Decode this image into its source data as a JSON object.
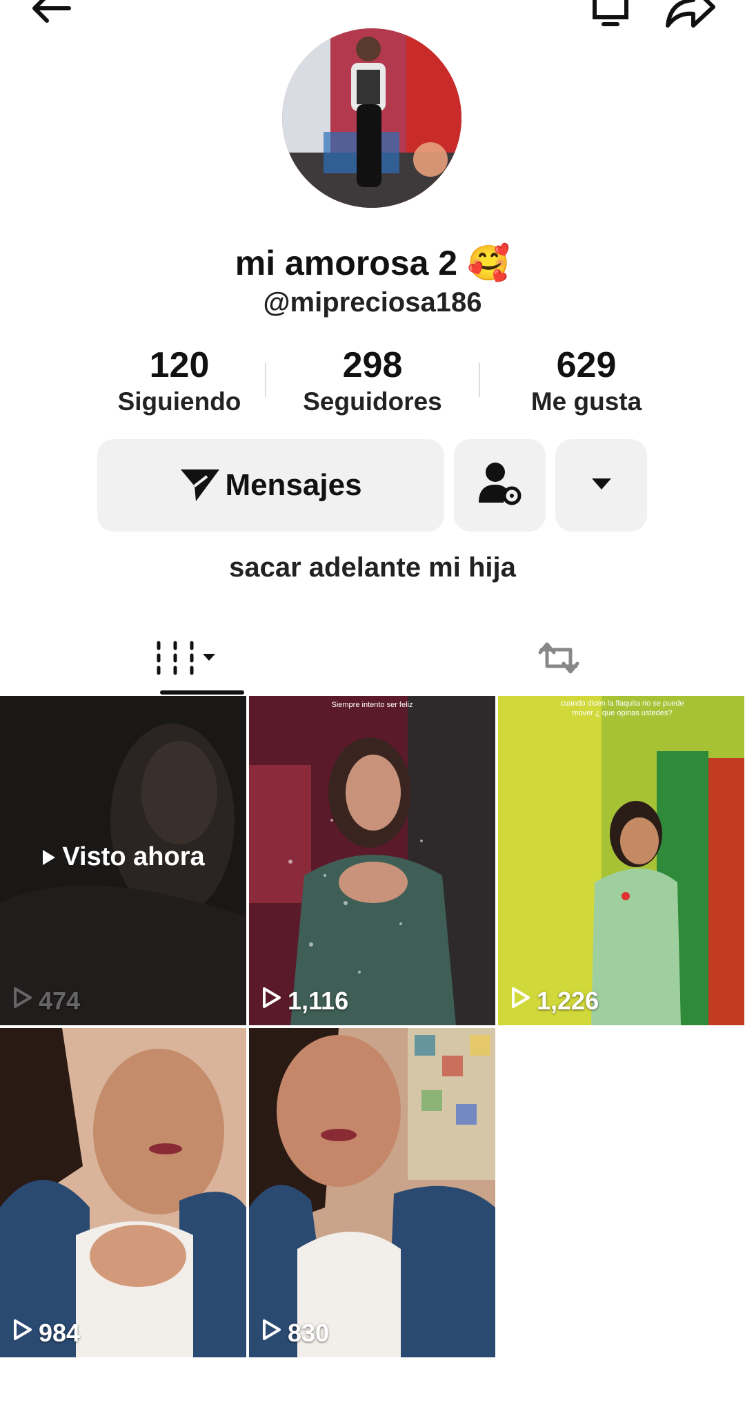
{
  "profile": {
    "display_name": "mi amorosa 2 🥰",
    "handle": "@mipreciosa186",
    "bio": "sacar adelante mi hija"
  },
  "stats": [
    {
      "value": "120",
      "label": "Siguiendo"
    },
    {
      "value": "298",
      "label": "Seguidores"
    },
    {
      "value": "629",
      "label": "Me gusta"
    }
  ],
  "actions": {
    "message_label": "Mensajes"
  },
  "icons": {
    "back": "back-arrow-icon",
    "bell": "bell-icon",
    "share": "share-icon",
    "send": "send-icon",
    "add_friend": "user-settings-icon",
    "dropdown": "caret-down-icon",
    "videos_tab": "grid-icon",
    "reposts_tab": "repost-icon",
    "play": "play-icon"
  },
  "videos": [
    {
      "views": "474",
      "overlay": "Visto ahora",
      "caption": ""
    },
    {
      "views": "1,116",
      "overlay": "",
      "caption": "Siempre intento ser feliz"
    },
    {
      "views": "1,226",
      "overlay": "",
      "caption": "cuando dicen la flaquita no se puede mover ¿ que opinas ustedes?"
    },
    {
      "views": "984",
      "overlay": "",
      "caption": ""
    },
    {
      "views": "830",
      "overlay": "",
      "caption": ""
    }
  ],
  "colors": {
    "button_bg": "#f1f1f1",
    "text": "#111111"
  }
}
